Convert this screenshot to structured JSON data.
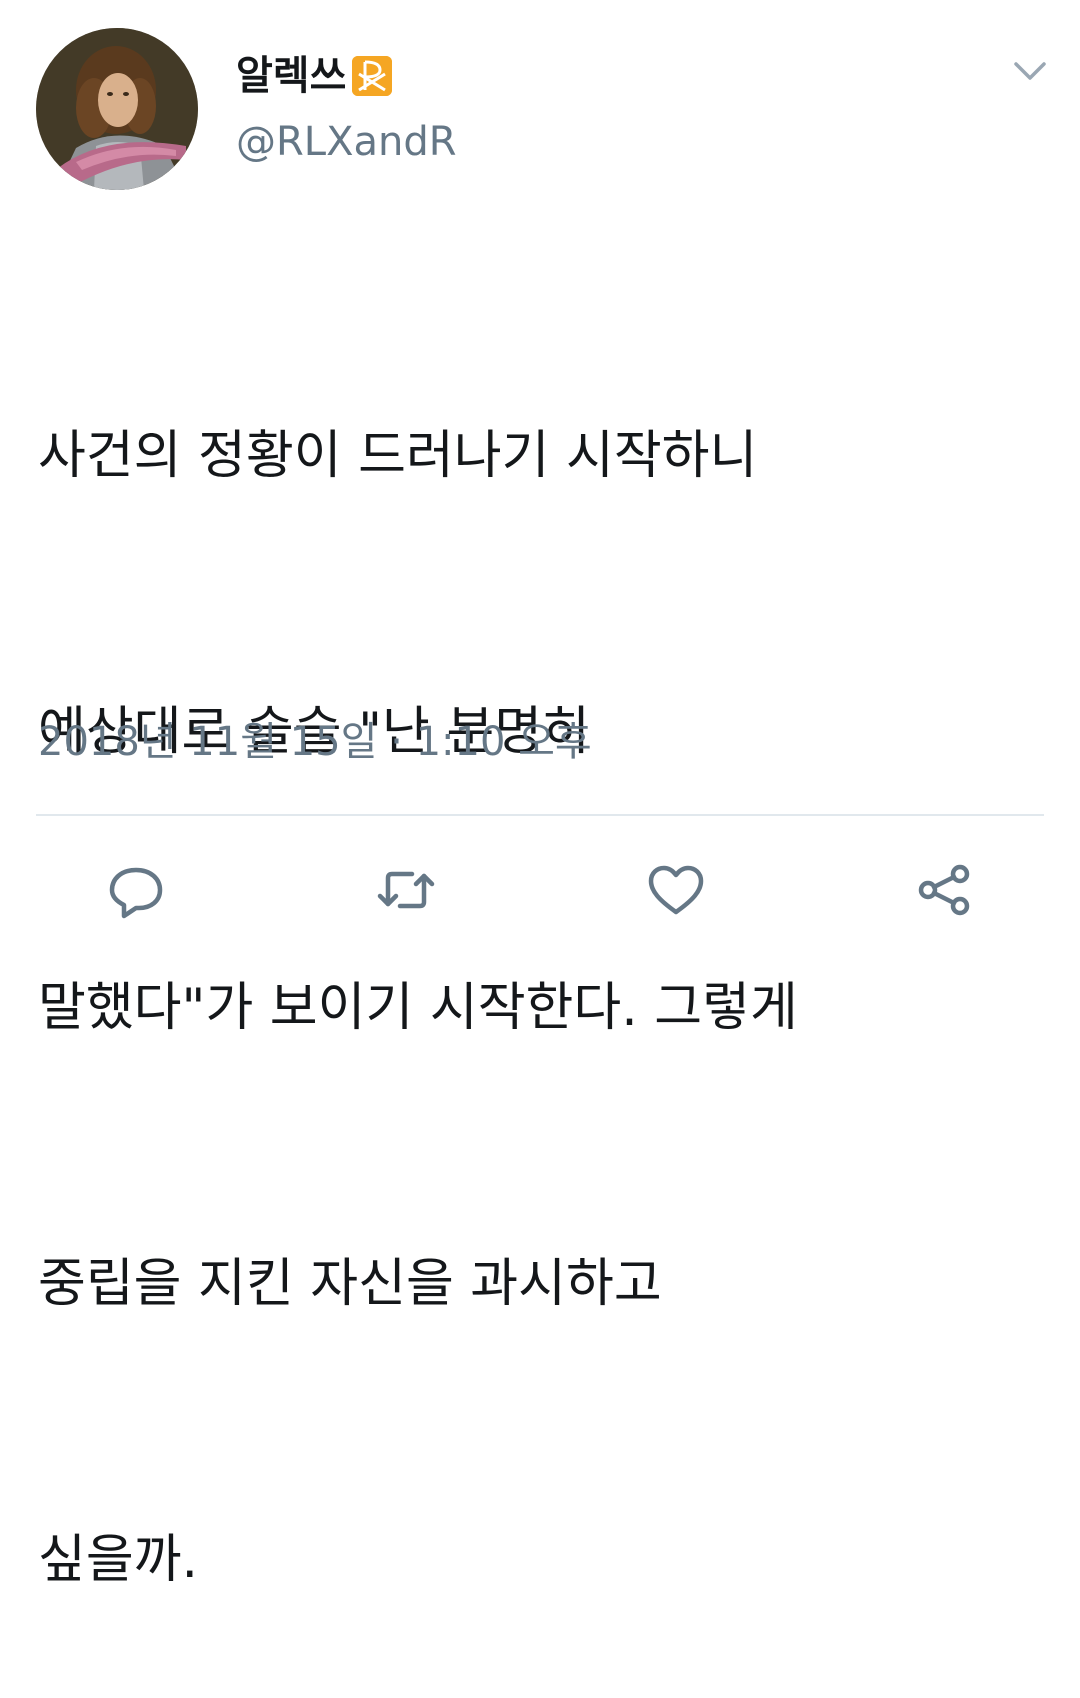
{
  "author": {
    "display_name": "알렉쓰",
    "badge_glyph": "☧",
    "handle": "@RLXandR",
    "avatar_icon": "portrait-avatar"
  },
  "tweet": {
    "lines": [
      "사건의 정황이 드러나기 시작하니",
      "예상대로 슬슬 \"난 분명히",
      "말했다\"가 보이기 시작한다. 그렇게",
      "중립을 지킨 자신을 과시하고",
      "싶을까."
    ],
    "timestamp": "2018년 11월 15일 · 1:10 오후"
  },
  "actions": {
    "reply_icon": "reply-icon",
    "retweet_icon": "retweet-icon",
    "like_icon": "heart-icon",
    "share_icon": "share-icon"
  },
  "colors": {
    "text": "#14171a",
    "secondary": "#657786",
    "icon": "#657786",
    "divider": "#e1e8ed",
    "badge": "#f5a623"
  }
}
